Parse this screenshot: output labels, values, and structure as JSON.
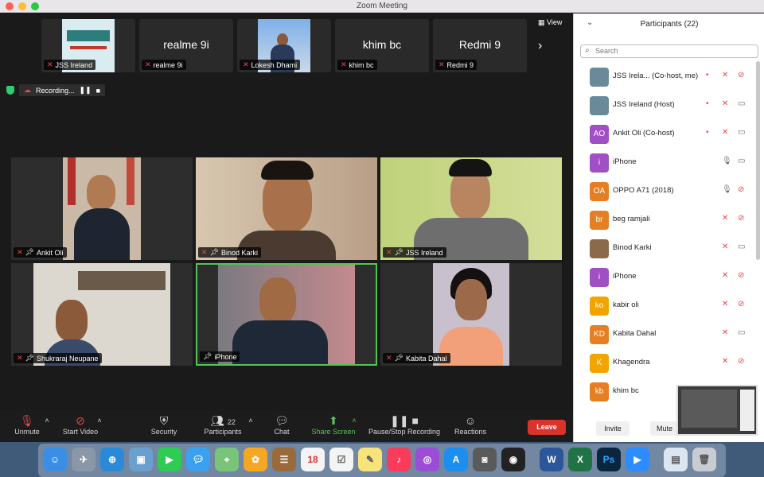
{
  "window": {
    "title": "Zoom Meeting"
  },
  "thumbnails": [
    {
      "name": "JSS Ireland",
      "big": ""
    },
    {
      "name": "realme 9i",
      "big": "realme 9i"
    },
    {
      "name": "Lokesh Dhami",
      "big": ""
    },
    {
      "name": "khim bc",
      "big": "khim bc"
    },
    {
      "name": "Redmi 9",
      "big": "Redmi 9"
    }
  ],
  "view_label": "View",
  "recording": {
    "label": "Recording..."
  },
  "tiles": [
    {
      "name": "Ankit Oli"
    },
    {
      "name": "Binod Karki"
    },
    {
      "name": "JSS Ireland"
    },
    {
      "name": "Shukraraj Neupane"
    },
    {
      "name": "iPhone"
    },
    {
      "name": "Kabita Dahal"
    }
  ],
  "toolbar": {
    "unmute": "Unmute",
    "start_video": "Start Video",
    "security": "Security",
    "participants": "Participants",
    "participants_count": "22",
    "chat": "Chat",
    "share_screen": "Share Screen",
    "pause_stop": "Pause/Stop Recording",
    "reactions": "Reactions",
    "leave": "Leave"
  },
  "panel": {
    "title": "Participants (22)",
    "search_placeholder": "Search",
    "invite": "Invite",
    "mute": "Mute",
    "participants": [
      {
        "name": "JSS Irela... (Co-host, me)",
        "avatar_text": "",
        "avatar_color": "#6a8a99"
      },
      {
        "name": "JSS Ireland (Host)",
        "avatar_text": "",
        "avatar_color": "#6a8a99"
      },
      {
        "name": "Ankit Oli (Co-host)",
        "avatar_text": "AO",
        "avatar_color": "#a04fc4"
      },
      {
        "name": "iPhone",
        "avatar_text": "i",
        "avatar_color": "#a04fc4"
      },
      {
        "name": "OPPO A71 (2018)",
        "avatar_text": "OA",
        "avatar_color": "#e67e22"
      },
      {
        "name": "beg ramjali",
        "avatar_text": "br",
        "avatar_color": "#e67e22"
      },
      {
        "name": "Binod Karki",
        "avatar_text": "",
        "avatar_color": "#8a6a4a"
      },
      {
        "name": "iPhone",
        "avatar_text": "i",
        "avatar_color": "#a04fc4"
      },
      {
        "name": "kabir oli",
        "avatar_text": "ko",
        "avatar_color": "#f0a500"
      },
      {
        "name": "Kabita Dahal",
        "avatar_text": "KD",
        "avatar_color": "#e67e22"
      },
      {
        "name": "Khagendra",
        "avatar_text": "K",
        "avatar_color": "#f0a500"
      },
      {
        "name": "khim bc",
        "avatar_text": "kb",
        "avatar_color": "#e67e22"
      }
    ]
  },
  "colors": {
    "accent_green": "#56c25b",
    "leave_red": "#d8342c",
    "mic_off_red": "#e5484d"
  }
}
